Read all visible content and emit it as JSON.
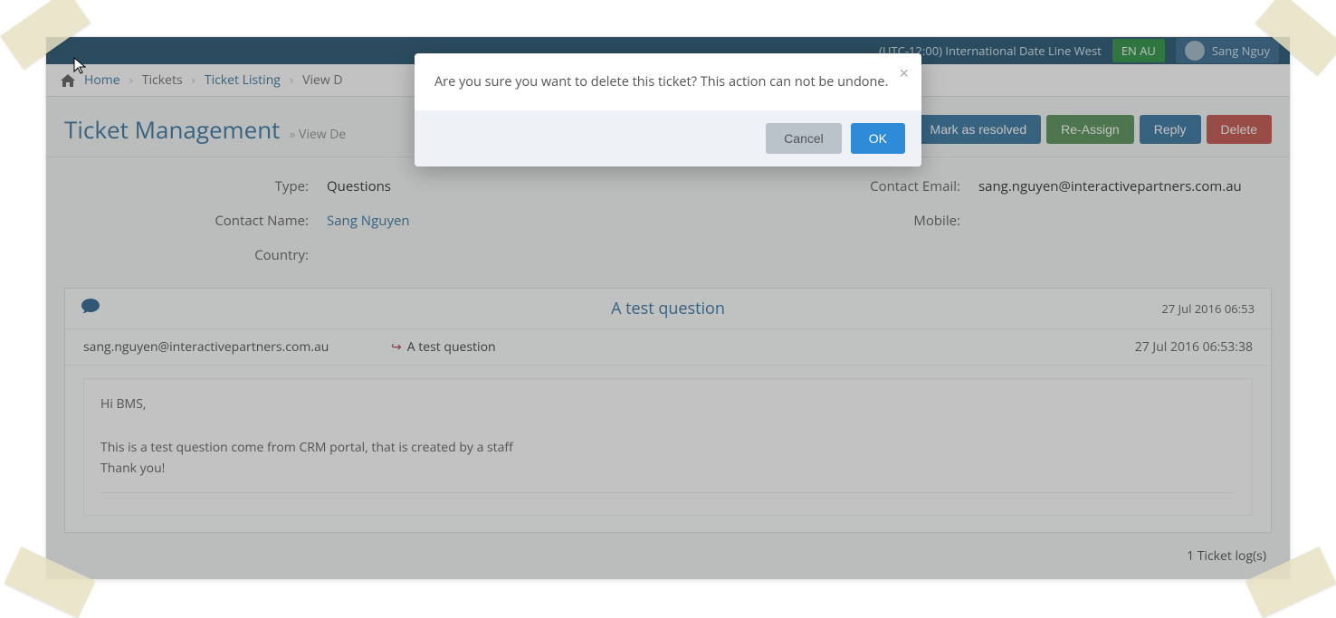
{
  "topbar": {
    "timezone": "(UTC-12:00) International Date Line West",
    "lang": "EN AU",
    "username": "Sang Nguy"
  },
  "breadcrumb": {
    "home": "Home",
    "tickets": "Tickets",
    "listing": "Ticket Listing",
    "view": "View D"
  },
  "page": {
    "title": "Ticket Management",
    "subtitle": "View De"
  },
  "actions": {
    "resolve": "Mark as resolved",
    "reassign": "Re-Assign",
    "reply": "Reply",
    "delete": "Delete"
  },
  "details": {
    "type_label": "Type:",
    "type_value": "Questions",
    "contact_email_label": "Contact Email:",
    "contact_email_value": "sang.nguyen@interactivepartners.com.au",
    "contact_name_label": "Contact Name:",
    "contact_name_value": "Sang Nguyen",
    "mobile_label": "Mobile:",
    "mobile_value": "",
    "country_label": "Country:",
    "country_value": ""
  },
  "ticket": {
    "title": "A test question",
    "head_ts": "27 Jul 2016 06:53",
    "log_from": "sang.nguyen@interactivepartners.com.au",
    "log_subject": "A test question",
    "log_ts": "27 Jul 2016 06:53:38",
    "body_line1": "Hi BMS,",
    "body_line2": "This is a test question come from CRM portal, that is created by a staff",
    "body_line3": "Thank you!",
    "footer_count": "1 Ticket log(s)"
  },
  "modal": {
    "message": "Are you sure you want to delete this ticket? This action can not be undone.",
    "cancel": "Cancel",
    "ok": "OK"
  }
}
